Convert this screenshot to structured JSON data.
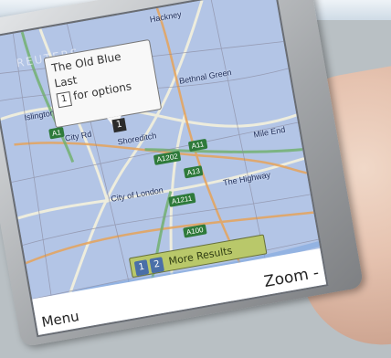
{
  "watermark": "REUTERS",
  "callout": {
    "title_line1": "The Old Blue",
    "title_line2": "Last",
    "key": "1",
    "option_text": "for options"
  },
  "pin_label": "1",
  "places": [
    "Islington",
    "City Rd",
    "Shoreditch",
    "City of London",
    "Mile End",
    "Bethnal Green",
    "The Highway",
    "Hackney"
  ],
  "roads": [
    "A1",
    "A1202",
    "A11",
    "A13",
    "A100",
    "A1211"
  ],
  "results_bar": {
    "page1": "1",
    "page2": "2",
    "label": "More Results"
  },
  "softkeys": {
    "left": "Menu",
    "right": "Zoom -"
  }
}
